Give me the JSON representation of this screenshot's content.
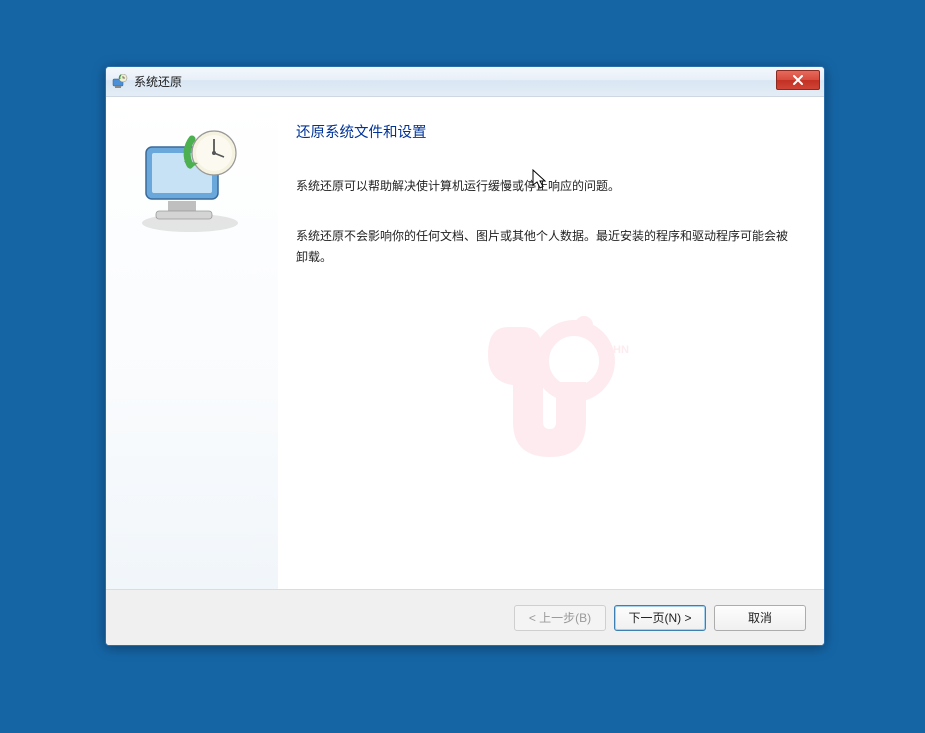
{
  "window": {
    "title": "系统还原"
  },
  "content": {
    "heading": "还原系统文件和设置",
    "paragraph1": "系统还原可以帮助解决使计算机运行缓慢或停止响应的问题。",
    "paragraph2": "系统还原不会影响你的任何文档、图片或其他个人数据。最近安装的程序和驱动程序可能会被卸载。"
  },
  "buttons": {
    "back": "< 上一步(B)",
    "next": "下一页(N) >",
    "cancel": "取消"
  },
  "watermark": {
    "label": "HN"
  }
}
